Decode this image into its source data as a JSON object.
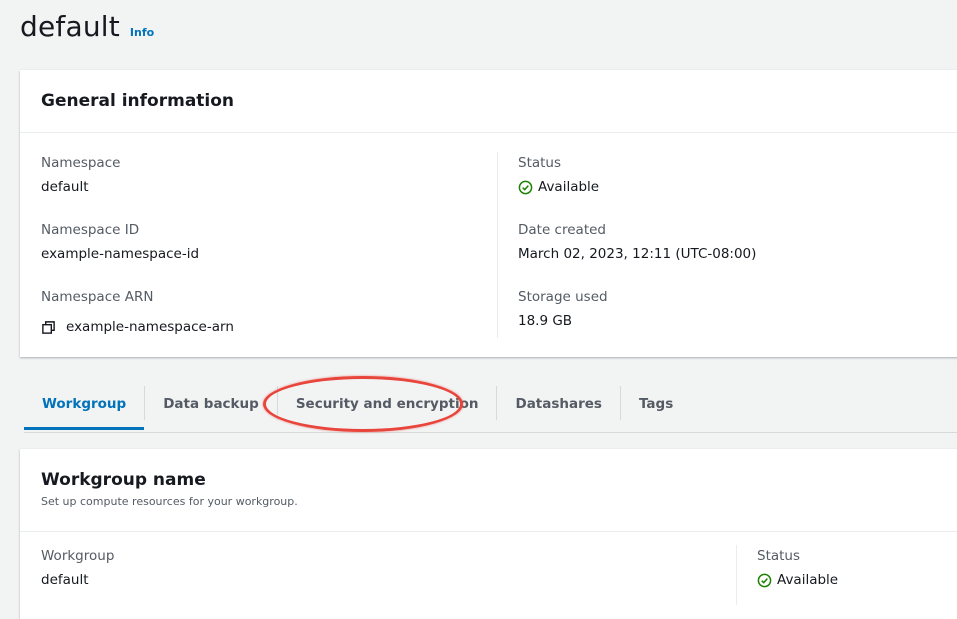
{
  "page": {
    "title": "default",
    "info_link": "Info"
  },
  "general": {
    "heading": "General information",
    "namespace_label": "Namespace",
    "namespace_value": "default",
    "namespace_id_label": "Namespace ID",
    "namespace_id_value": "example-namespace-id",
    "namespace_arn_label": "Namespace ARN",
    "namespace_arn_value": "example-namespace-arn",
    "status_label": "Status",
    "status_value": "Available",
    "date_created_label": "Date created",
    "date_created_value": "March 02, 2023, 12:11 (UTC-08:00)",
    "storage_label": "Storage used",
    "storage_value": "18.9 GB"
  },
  "tabs": [
    {
      "label": "Workgroup",
      "active": true
    },
    {
      "label": "Data backup",
      "active": false
    },
    {
      "label": "Security and encryption",
      "active": false,
      "highlighted": true
    },
    {
      "label": "Datashares",
      "active": false
    },
    {
      "label": "Tags",
      "active": false
    }
  ],
  "workgroup": {
    "heading": "Workgroup name",
    "description": "Set up compute resources for your workgroup.",
    "workgroup_label": "Workgroup",
    "workgroup_value": "default",
    "status_label": "Status",
    "status_value": "Available"
  },
  "colors": {
    "link": "#0073bb",
    "success": "#1d8102",
    "highlight": "#e8453c",
    "background": "#f2f3f3"
  },
  "icons": {
    "status": "check-circle-icon",
    "copy": "copy-icon"
  }
}
